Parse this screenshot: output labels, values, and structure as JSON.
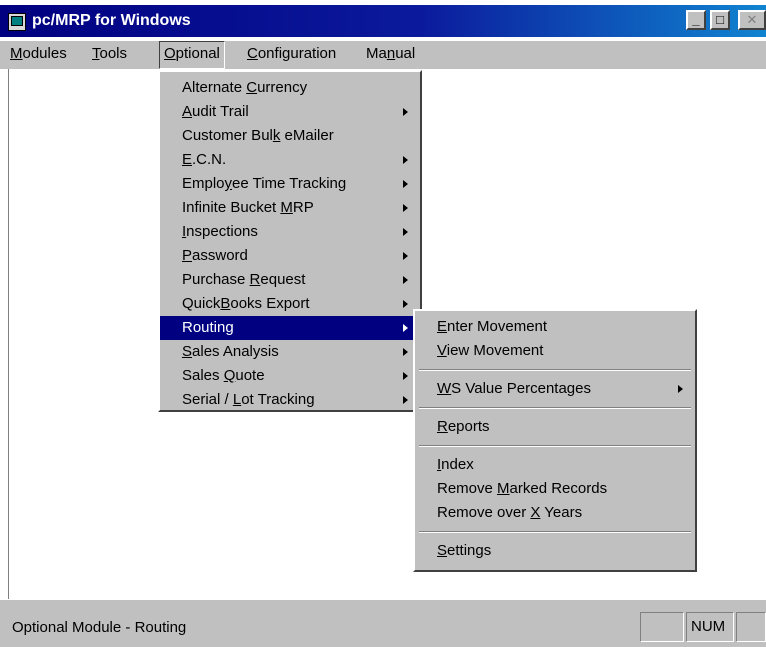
{
  "window": {
    "title": "pc/MRP for Windows",
    "buttons": {
      "minimize": "_",
      "maximize": "□",
      "close": "✕"
    }
  },
  "menubar": {
    "modules": {
      "pre": "",
      "u": "M",
      "post": "odules"
    },
    "tools": {
      "pre": "",
      "u": "T",
      "post": "ools"
    },
    "optional": {
      "pre": "",
      "u": "O",
      "post": "ptional"
    },
    "configuration": {
      "pre": "",
      "u": "C",
      "post": "onfiguration"
    },
    "manual": {
      "pre": "Ma",
      "u": "n",
      "post": "ual"
    }
  },
  "optional_menu": {
    "alternate_currency": {
      "pre": "Alternate ",
      "u": "C",
      "post": "urrency"
    },
    "audit_trail": {
      "pre": "",
      "u": "A",
      "post": "udit Trail"
    },
    "customer_bulk_emailer": {
      "pre": "Customer Bul",
      "u": "k",
      "post": " eMailer"
    },
    "ecn": {
      "pre": "",
      "u": "E",
      "post": ".C.N."
    },
    "employee_time_tracking": {
      "pre": "Emplo",
      "u": "y",
      "post": "ee Time Tracking"
    },
    "infinite_bucket_mrp": {
      "pre": "Infinite Bucket ",
      "u": "M",
      "post": "RP"
    },
    "inspections": {
      "pre": "",
      "u": "I",
      "post": "nspections"
    },
    "password": {
      "pre": "",
      "u": "P",
      "post": "assword"
    },
    "purchase_request": {
      "pre": "Purchase ",
      "u": "R",
      "post": "equest"
    },
    "quickbooks_export": {
      "pre": "Quick",
      "u": "B",
      "post": "ooks Export"
    },
    "routing": {
      "pre": "Routing",
      "u": "",
      "post": ""
    },
    "sales_analysis": {
      "pre": "",
      "u": "S",
      "post": "ales Analysis"
    },
    "sales_quote": {
      "pre": "Sales ",
      "u": "Q",
      "post": "uote"
    },
    "serial_lot_tracking": {
      "pre": "Serial / ",
      "u": "L",
      "post": "ot Tracking"
    }
  },
  "routing_menu": {
    "enter_movement": {
      "pre": "",
      "u": "E",
      "post": "nter  Movement"
    },
    "view_movement": {
      "pre": "",
      "u": "V",
      "post": "iew  Movement"
    },
    "ws_value_percentages": {
      "pre": "",
      "u": "W",
      "post": "S Value Percentages"
    },
    "reports": {
      "pre": "",
      "u": "R",
      "post": "eports"
    },
    "index": {
      "pre": "",
      "u": "I",
      "post": "ndex"
    },
    "remove_marked_records": {
      "pre": "Remove ",
      "u": "M",
      "post": "arked Records"
    },
    "remove_over_x_years": {
      "pre": "Remove over ",
      "u": "X",
      "post": " Years"
    },
    "settings": {
      "pre": "",
      "u": "S",
      "post": "ettings"
    }
  },
  "statusbar": {
    "message": "Optional Module - Routing",
    "num": "NUM"
  },
  "colors": {
    "titlebar": "#000080",
    "menu_face": "#c0c0c0",
    "selection": "#000080",
    "client": "#ffffff"
  }
}
